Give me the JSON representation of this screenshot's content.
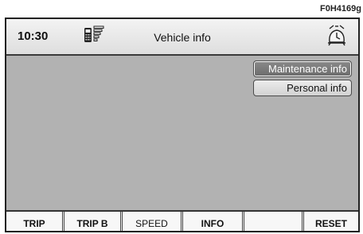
{
  "figure_code": "F0H4169g",
  "header": {
    "time": "10:30",
    "title": "Vehicle info",
    "icons": [
      "phone-signal-icon",
      "alarm-clock-icon"
    ]
  },
  "menu": {
    "items": [
      {
        "label": "Maintenance info",
        "selected": true
      },
      {
        "label": "Personal info",
        "selected": false
      }
    ]
  },
  "footer": {
    "keys": [
      {
        "label": "TRIP"
      },
      {
        "label": "TRIP B"
      },
      {
        "label": "SPEED"
      },
      {
        "label": "INFO"
      },
      {
        "label": ""
      },
      {
        "label": "RESET"
      }
    ]
  },
  "colors": {
    "screen_background": "#b2b2b2",
    "selected_button": "#7a7a7a"
  }
}
